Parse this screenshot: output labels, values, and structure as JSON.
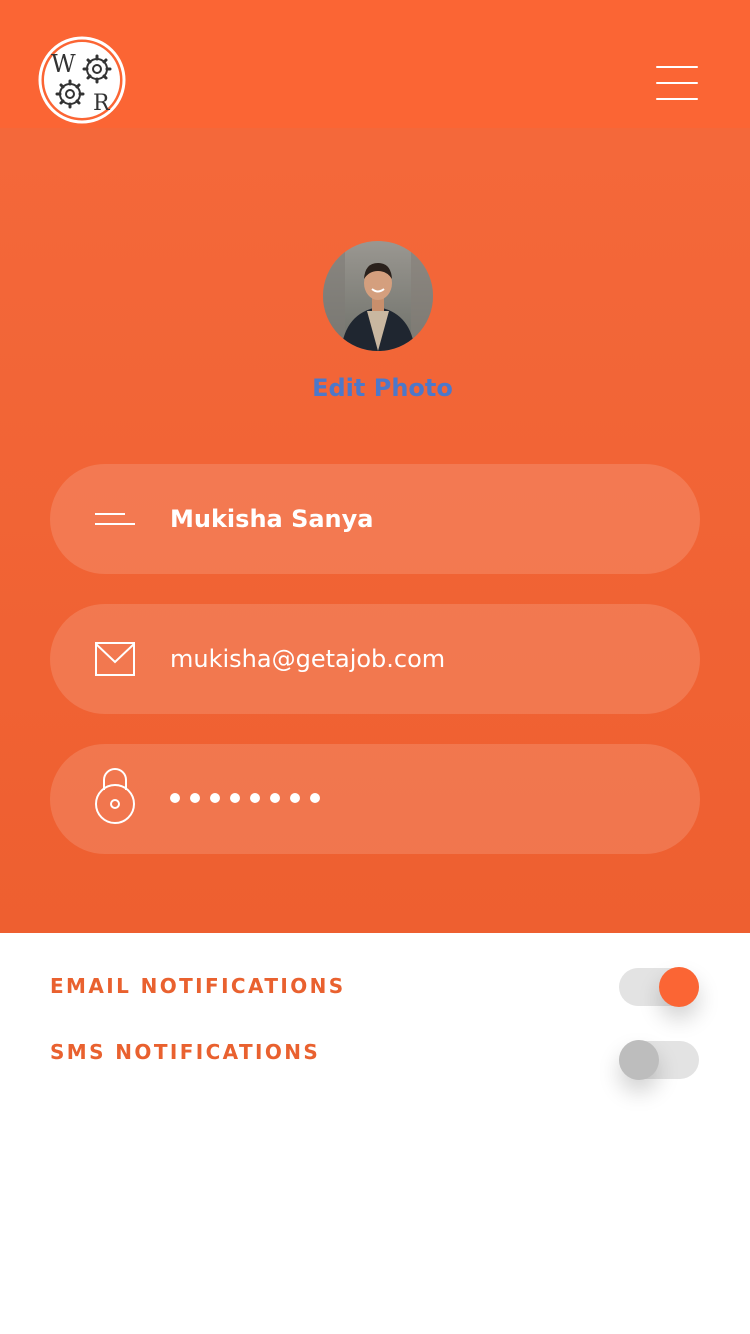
{
  "header": {
    "logo_letters": "WR",
    "logo_icon": "gears-logo",
    "menu_icon": "hamburger-menu-icon"
  },
  "profile": {
    "edit_photo_label": "Edit Photo",
    "avatar_alt": "profile photo"
  },
  "fields": {
    "name": {
      "icon": "name-lines-icon",
      "value": "Mukisha Sanya"
    },
    "email": {
      "icon": "mail-icon",
      "value": "mukisha@getajob.com"
    },
    "password": {
      "icon": "lock-icon",
      "mask_length": 8
    }
  },
  "notifications": [
    {
      "label": "EMAIL NOTIFICATIONS",
      "enabled": true
    },
    {
      "label": "SMS NOTIFICATIONS",
      "enabled": false
    }
  ],
  "colors": {
    "accent": "#fb6534",
    "panel": "#ef6231",
    "link": "#4d78c9",
    "toggle_off": "#bdbdbd",
    "track": "#e3e3e3"
  }
}
